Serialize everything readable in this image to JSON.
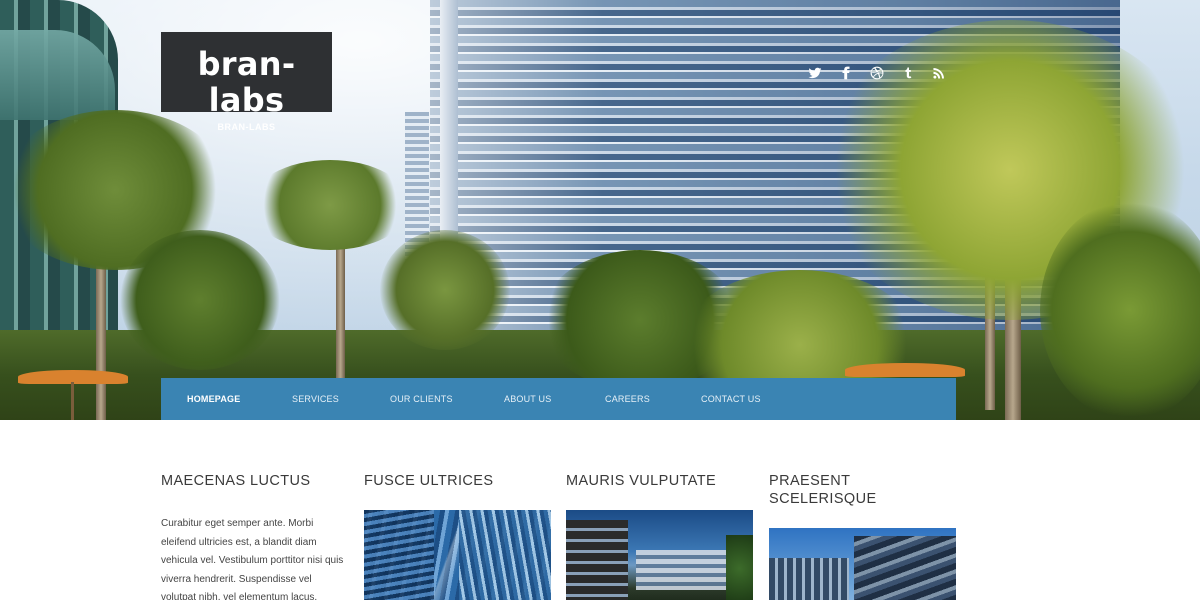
{
  "site": {
    "title": "bran-labs",
    "tagline": "BRAN-LABS"
  },
  "social": [
    {
      "name": "twitter-icon"
    },
    {
      "name": "facebook-icon"
    },
    {
      "name": "dribbble-icon"
    },
    {
      "name": "tumblr-icon"
    },
    {
      "name": "rss-icon"
    }
  ],
  "nav": {
    "items": [
      {
        "label": "HOMEPAGE",
        "active": true
      },
      {
        "label": "SERVICES"
      },
      {
        "label": "OUR CLIENTS"
      },
      {
        "label": "ABOUT US"
      },
      {
        "label": "CAREERS"
      },
      {
        "label": "CONTACT US"
      }
    ]
  },
  "colors": {
    "nav_bg": "#3a84b3",
    "logo_bg": "#2e3033"
  },
  "columns": [
    {
      "title": "MAECENAS LUCTUS",
      "text": "Curabitur eget semper ante. Morbi eleifend ultricies est, a blandit diam vehicula vel. Vestibulum porttitor nisi quis viverra hendrerit. Suspendisse vel volutpat nibh, vel elementum lacus."
    },
    {
      "title": "FUSCE ULTRICES"
    },
    {
      "title": "MAURIS VULPUTATE"
    },
    {
      "title": "PRAESENT SCELERISQUE"
    }
  ]
}
